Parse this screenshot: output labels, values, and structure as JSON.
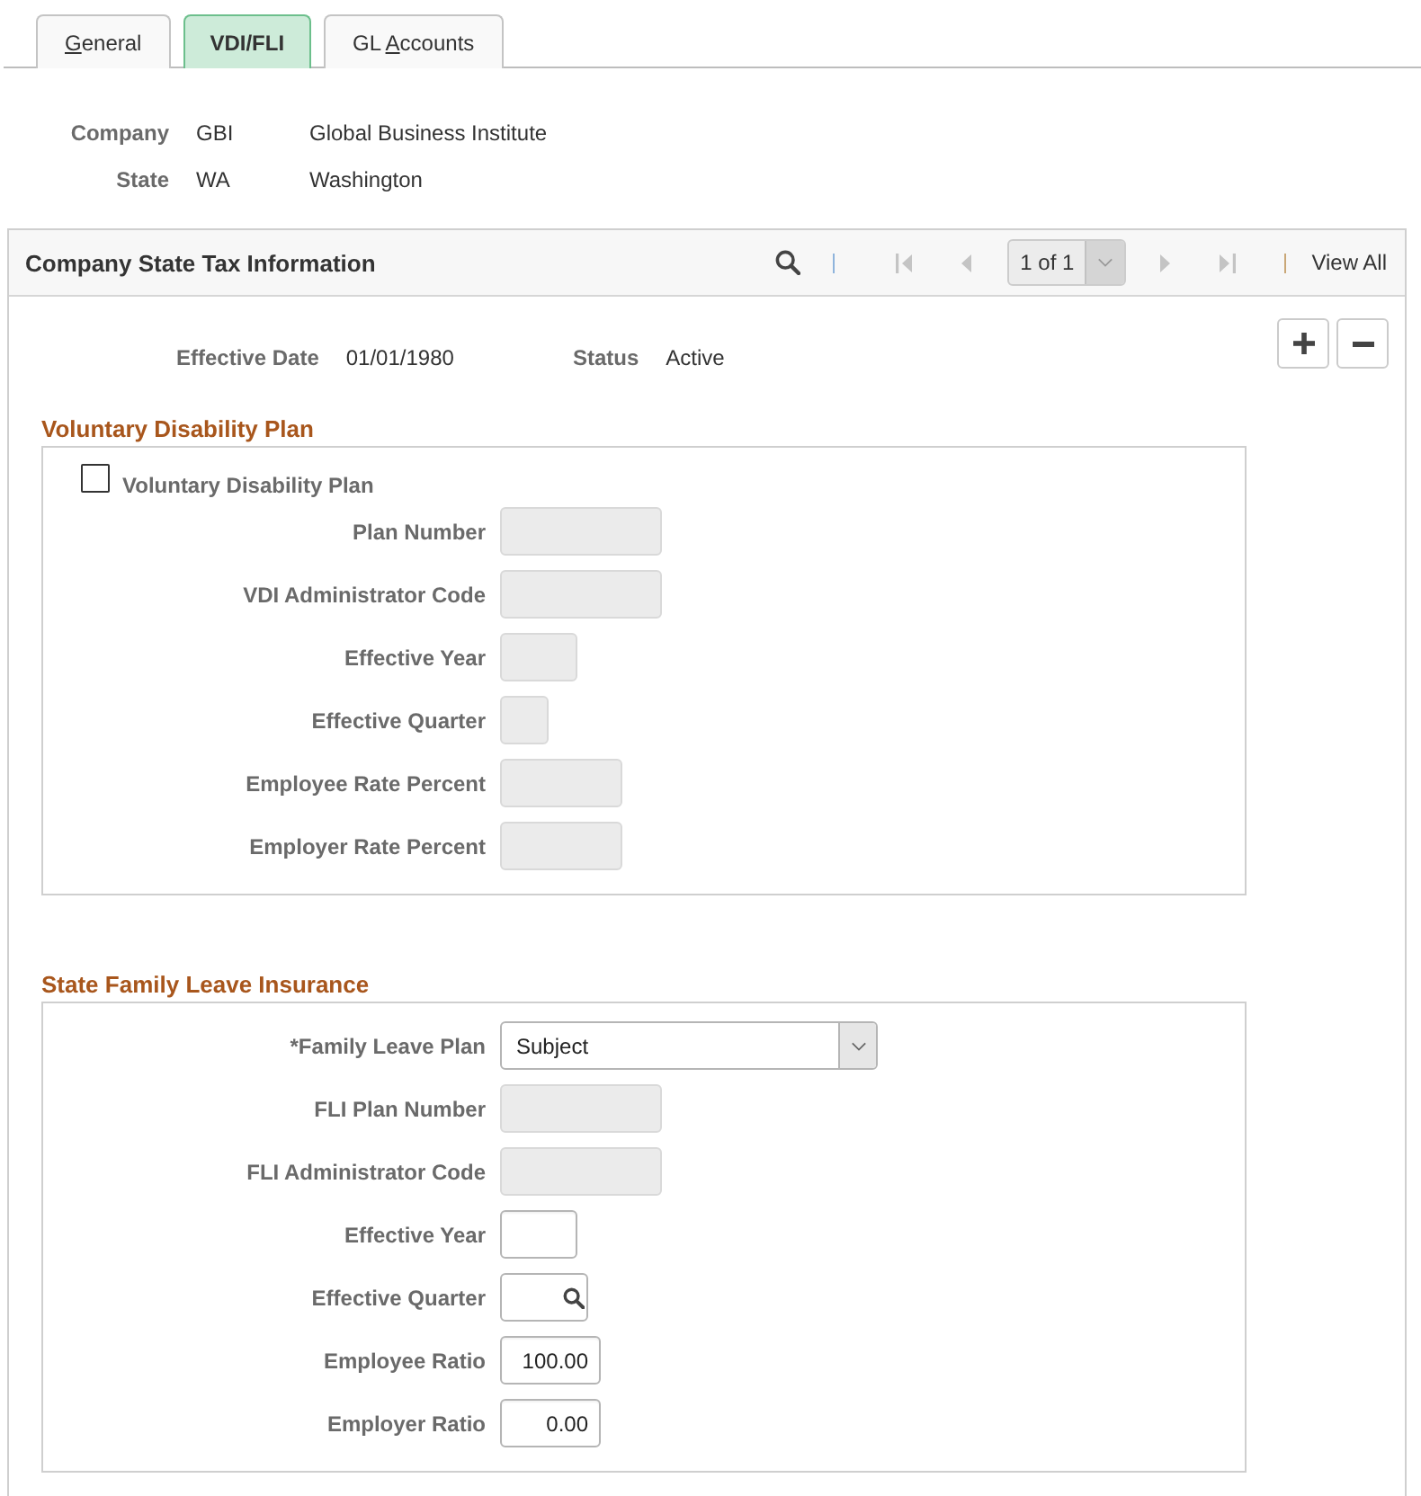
{
  "tabs": [
    {
      "mnemonic": "G",
      "label_end": "eneral",
      "selected": false
    },
    {
      "label_start": "VDI/FLI",
      "selected": true
    },
    {
      "label_start": "GL ",
      "mnemonic": "A",
      "label_end": "ccounts",
      "selected": false
    }
  ],
  "header_fields": [
    {
      "label": "Company",
      "value": "GBI",
      "description": "Global Business Institute"
    },
    {
      "label": "State",
      "value": "WA",
      "description": "Washington"
    }
  ],
  "panel": {
    "title": "Company State Tax Information",
    "pager": {
      "buttons": [
        {
          "kind": "first",
          "disabled": true
        },
        {
          "kind": "previous",
          "disabled": true
        },
        {
          "kind": "next",
          "disabled": true
        },
        {
          "kind": "last",
          "disabled": true
        }
      ],
      "position": "1 of 1",
      "view_all": "View All"
    },
    "key_fields": [
      {
        "label": "Effective Date",
        "value": "01/01/1980"
      },
      {
        "label": "Status",
        "value": "Active"
      }
    ]
  },
  "sections": [
    {
      "heading": "Voluntary Disability Plan",
      "rows": [
        {
          "kind": "checkbox",
          "label": "Voluntary Disability Plan",
          "checked": false
        },
        {
          "kind": "text",
          "label": "Plan Number",
          "disabled": true
        },
        {
          "kind": "text",
          "label": "VDI Administrator Code",
          "disabled": true
        },
        {
          "kind": "year",
          "label": "Effective Year",
          "disabled": true
        },
        {
          "kind": "quarter",
          "label": "Effective Quarter",
          "disabled": true
        },
        {
          "kind": "rate",
          "label": "Employee Rate Percent",
          "disabled": true
        },
        {
          "kind": "rate",
          "label": "Employer Rate Percent",
          "disabled": true
        }
      ]
    },
    {
      "heading": "State Family Leave Insurance",
      "rows": [
        {
          "kind": "dropdown",
          "label": "*Family Leave Plan",
          "value": "Subject"
        },
        {
          "kind": "text",
          "label": "FLI Plan Number",
          "disabled": true
        },
        {
          "kind": "text",
          "label": "FLI Administrator Code",
          "disabled": true
        },
        {
          "kind": "year",
          "label": "Effective Year",
          "disabled": false
        },
        {
          "kind": "lookup",
          "label": "Effective Quarter",
          "disabled": false
        },
        {
          "kind": "ratio",
          "label": "Employee Ratio",
          "value": "100.00",
          "disabled": false
        },
        {
          "kind": "ratio",
          "label": "Employer Ratio",
          "value": "0.00",
          "disabled": false
        }
      ]
    }
  ]
}
